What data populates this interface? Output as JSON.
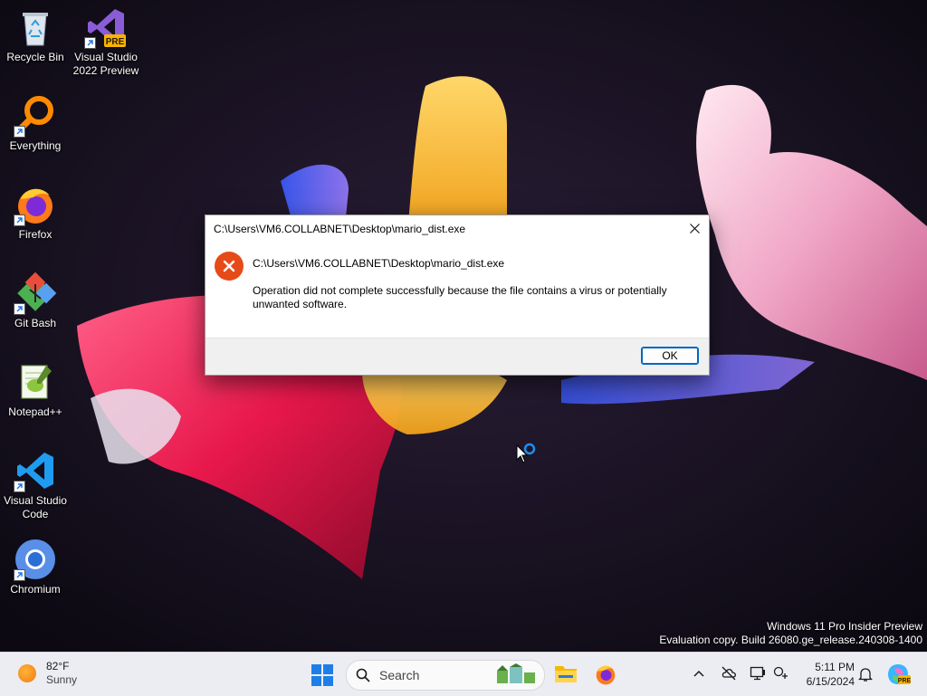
{
  "desktop": {
    "icons": [
      {
        "label": "Recycle Bin"
      },
      {
        "label": "Visual Studio 2022 Preview",
        "badge": "PRE"
      },
      {
        "label": "Everything"
      },
      {
        "label": "Firefox"
      },
      {
        "label": "Git Bash"
      },
      {
        "label": "Notepad++"
      },
      {
        "label": "Visual Studio Code"
      },
      {
        "label": "Chromium"
      }
    ],
    "watermark": {
      "line1": "Windows 11 Pro Insider Preview",
      "line2": "Evaluation copy. Build 26080.ge_release.240308-1400"
    }
  },
  "dialog": {
    "title": "C:\\Users\\VM6.COLLABNET\\Desktop\\mario_dist.exe",
    "heading": "C:\\Users\\VM6.COLLABNET\\Desktop\\mario_dist.exe",
    "message": "Operation did not complete successfully because the file contains a virus or potentially unwanted software.",
    "ok_label": "OK",
    "icon": "error-icon"
  },
  "taskbar": {
    "weather": {
      "temp": "82°F",
      "condition": "Sunny"
    },
    "search": {
      "placeholder": "Search"
    },
    "clock": {
      "time": "5:11 PM",
      "date": "6/15/2024"
    },
    "colors": {
      "accent": "#0067c0",
      "background": "#ecedf2"
    }
  }
}
